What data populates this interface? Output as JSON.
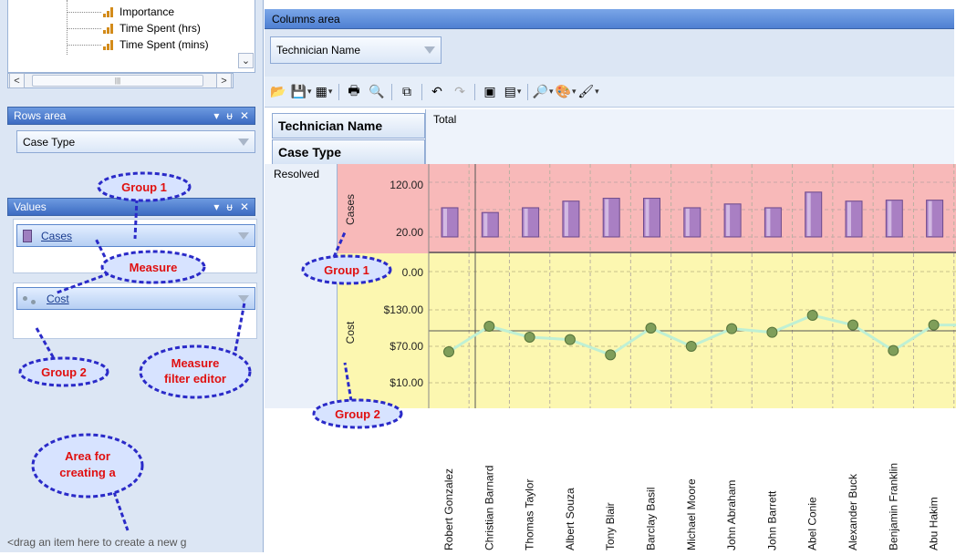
{
  "field_list": {
    "items": [
      {
        "label": "Importance",
        "icon": "bar-chart-icon"
      },
      {
        "label": "Time Spent (hrs)",
        "icon": "bar-chart-icon"
      },
      {
        "label": "Time Spent (mins)",
        "icon": "bar-chart-icon"
      }
    ]
  },
  "rows_area": {
    "title": "Rows area",
    "pin": "ᵾ",
    "close": "✕",
    "field": "Case Type"
  },
  "values_area": {
    "title": "Values",
    "pin": "ᵾ",
    "close": "✕",
    "measure_1": "Cases",
    "measure_2": "Cost"
  },
  "drop_hint": "<drag an item here to create a new g",
  "columns_area": {
    "title": "Columns area",
    "field": "Technician Name"
  },
  "grid": {
    "col_header": "Technician Name",
    "row_header": "Case Type",
    "total_label": "Total",
    "row_value": "Resolved"
  },
  "callouts": {
    "group1_top": "Group 1",
    "measure": "Measure",
    "group2_left": "Group 2",
    "filter_editor_1": "Measure",
    "filter_editor_2": "filter editor",
    "area_1": "Area for",
    "area_2": "creating a",
    "group1_chart": "Group 1",
    "group2_chart": "Group 2"
  },
  "colors": {
    "cases_band": "#f8b9b9",
    "cost_band": "#fcf7b0",
    "bar_fill": "#a97fc3",
    "line": "#bff0d4",
    "point": "#7f9e5a",
    "callout_fill": "#d7e3ff",
    "callout_border": "#2a2ac8"
  },
  "chart_data": {
    "type": "bar",
    "categories": [
      "Robert Gonzalez",
      "Christian Barnard",
      "Thomas Taylor",
      "Albert Souza",
      "Tony Blair",
      "Barclay Basil",
      "Michael Moore",
      "John Abraham",
      "John Barrett",
      "Abel Conie",
      "Alexander Buck",
      "Benjamin Franklin",
      "Abu Hakim"
    ],
    "series": [
      {
        "name": "Cases",
        "type": "bar",
        "values": [
          72,
          62,
          72,
          86,
          92,
          92,
          72,
          80,
          72,
          105,
          86,
          88,
          88
        ]
      },
      {
        "name": "Cost",
        "type": "line",
        "values": [
          61,
          103,
          85,
          81,
          56,
          100,
          70,
          99,
          93,
          121,
          105,
          63,
          105
        ]
      }
    ],
    "cases_axis": {
      "label": "Cases",
      "ticks": [
        "120.00",
        "20.00"
      ],
      "tick_values": [
        120,
        20
      ]
    },
    "cost_axis": {
      "label": "Cost",
      "ticks": [
        "$130.00",
        "$70.00",
        "$10.00"
      ],
      "tick_values": [
        130,
        70,
        10
      ]
    },
    "top_tick": "0.00"
  }
}
